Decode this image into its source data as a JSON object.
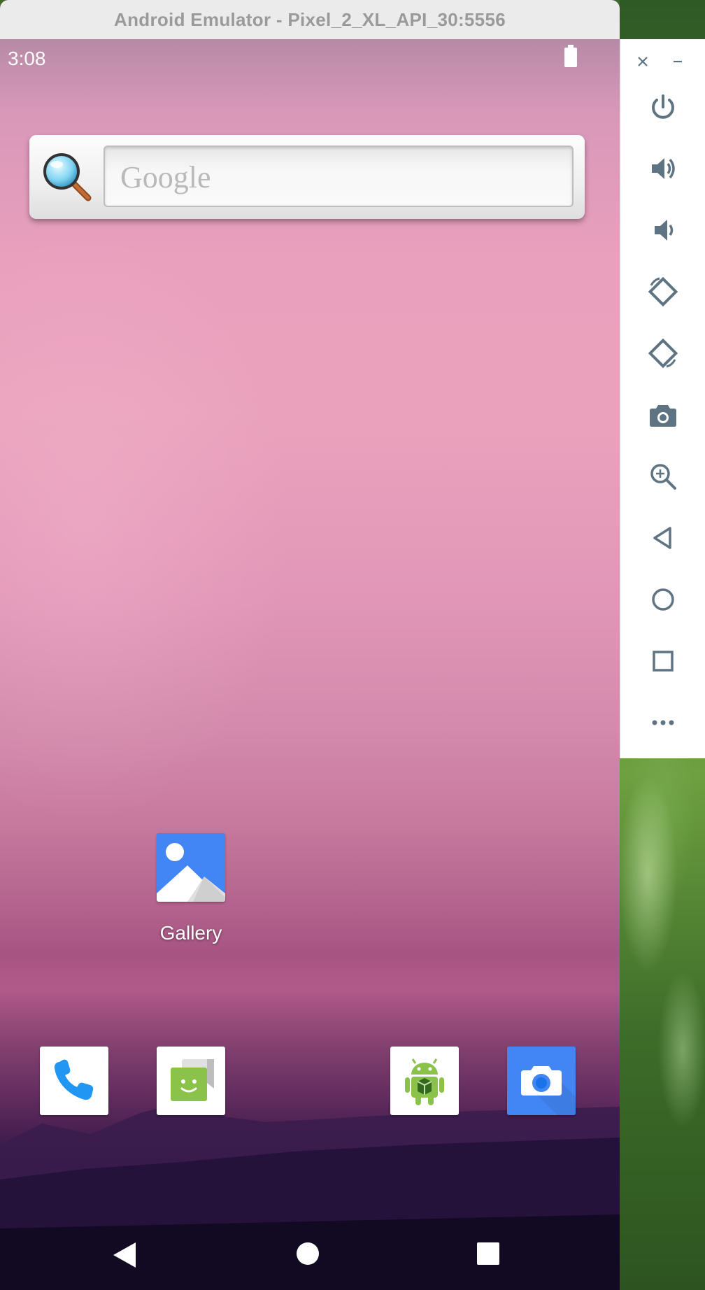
{
  "window": {
    "title": "Android Emulator - Pixel_2_XL_API_30:5556"
  },
  "status_bar": {
    "time": "3:08",
    "battery_icon": "battery-full-icon"
  },
  "search_widget": {
    "placeholder": "Google",
    "icon": "magnifier-icon"
  },
  "home": {
    "apps": [
      {
        "label": "Gallery",
        "icon": "gallery-icon"
      }
    ],
    "dock": [
      {
        "icon": "phone-icon"
      },
      {
        "icon": "messaging-icon"
      },
      {
        "icon": "android-robot-icon"
      },
      {
        "icon": "camera-icon"
      }
    ]
  },
  "nav_bar": {
    "back": "back-triangle-icon",
    "home": "home-circle-icon",
    "recents": "recents-square-icon"
  },
  "toolbar": {
    "items": [
      "close-icon",
      "minimize-icon",
      "power-icon",
      "volume-up-icon",
      "volume-down-icon",
      "rotate-left-icon",
      "rotate-right-icon",
      "screenshot-camera-icon",
      "zoom-icon",
      "back-icon",
      "home-icon",
      "overview-icon",
      "more-icon"
    ]
  },
  "colors": {
    "accent_blue": "#4285f4",
    "toolbar_icon": "#5f7482"
  }
}
